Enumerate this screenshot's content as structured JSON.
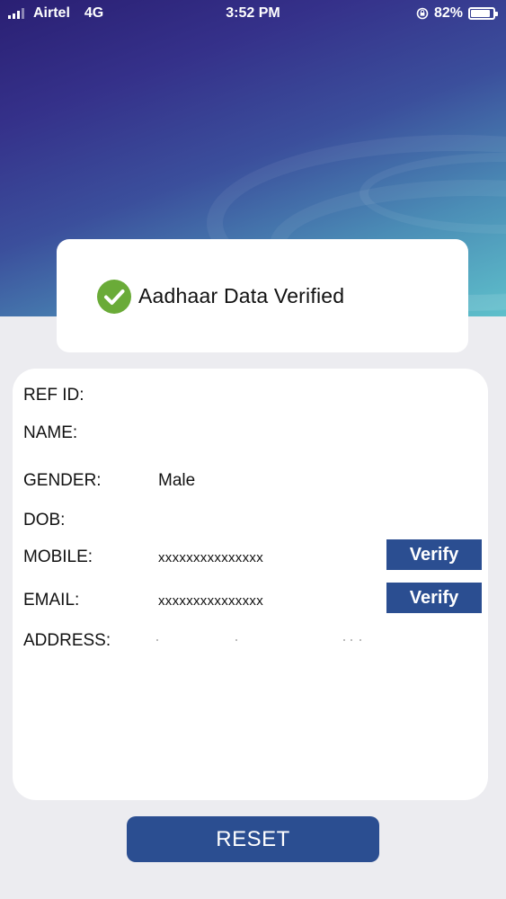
{
  "status_bar": {
    "carrier": "Airtel",
    "network": "4G",
    "time": "3:52 PM",
    "battery": "82%",
    "battery_level": 0.82,
    "icons": [
      "signal-icon",
      "rotation-lock-icon",
      "battery-icon"
    ]
  },
  "verification": {
    "message": "Aadhaar Data Verified",
    "icon": "check-circle-icon",
    "icon_color": "#6aab38"
  },
  "details": {
    "ref_id_label": "REF ID:",
    "name_label": "NAME:",
    "gender_label": "GENDER:",
    "gender_value": "Male",
    "dob_label": "DOB:",
    "mobile_label": "MOBILE:",
    "mobile_value": "xxxxxxxxxxxxxxx",
    "mobile_verify_label": "Verify",
    "email_label": "EMAIL:",
    "email_value": "xxxxxxxxxxxxxxx",
    "email_verify_label": "Verify",
    "address_label": "ADDRESS:"
  },
  "actions": {
    "reset_label": "RESET"
  },
  "colors": {
    "primary_button": "#2b4e91",
    "background": "#ececf0"
  }
}
